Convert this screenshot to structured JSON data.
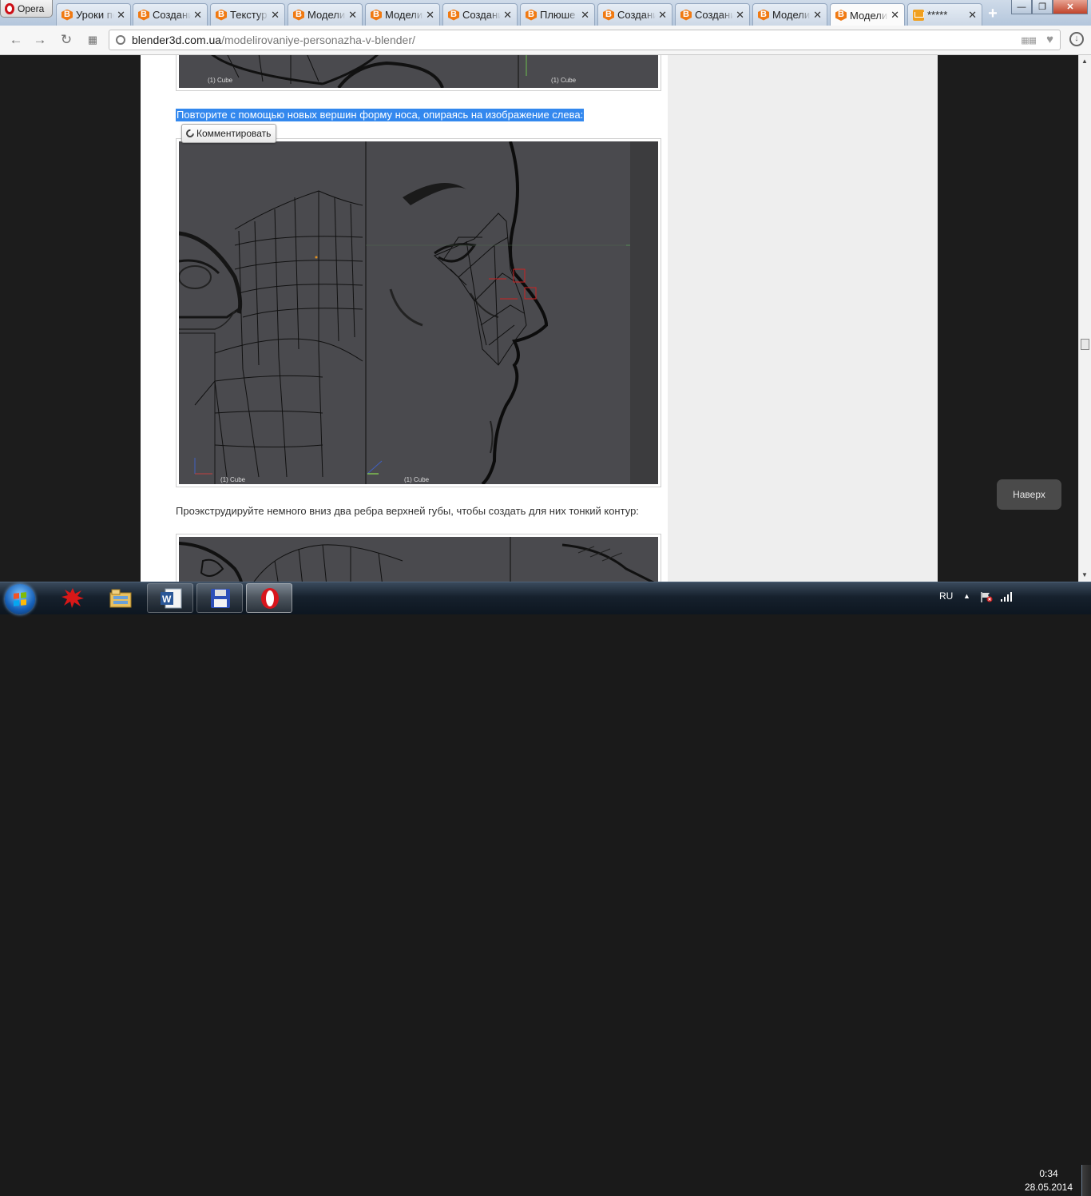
{
  "browser": {
    "menu_label": "Opera",
    "tabs": [
      {
        "title": "Уроки по",
        "icon": "blender3d-favicon",
        "close": "✕"
      },
      {
        "title": "Создание",
        "icon": "blender3d-favicon",
        "close": "✕"
      },
      {
        "title": "Текстур",
        "icon": "blender3d-favicon",
        "close": "✕"
      },
      {
        "title": "Модели",
        "icon": "blender3d-favicon",
        "close": "✕"
      },
      {
        "title": "Модели",
        "icon": "blender3d-favicon",
        "close": "✕"
      },
      {
        "title": "Создани",
        "icon": "blender3d-favicon",
        "close": "✕"
      },
      {
        "title": "Плюше",
        "icon": "blender3d-favicon",
        "close": "✕"
      },
      {
        "title": "Создани",
        "icon": "blender3d-favicon",
        "close": "✕"
      },
      {
        "title": "Создани",
        "icon": "blender3d-favicon",
        "close": "✕"
      },
      {
        "title": "Модели",
        "icon": "blender3d-favicon",
        "close": "✕"
      },
      {
        "title": "Модели",
        "icon": "blender3d-favicon",
        "close": "✕",
        "active": true
      },
      {
        "title": "*****",
        "icon": "mail-favicon",
        "close": "✕"
      }
    ],
    "new_tab_label": "+",
    "address": {
      "host": "blender3d.com.ua",
      "path": "/modelirovaniye-personazha-v-blender/"
    }
  },
  "article": {
    "highlighted_text": "Повторите с помощью новых вершин форму носа, опираясь на изображение слева:",
    "comment_button": "Комментировать",
    "paragraph_2": "Проэкструдируйте немного вниз два ребра верхней губы, чтобы создать для них тонкий контур:",
    "viewport_labels": [
      "(1) Cube",
      "(1) Cube",
      "(1) Cube",
      "(1) Cube"
    ]
  },
  "back_to_top": "Наверх",
  "taskbar": {
    "apps": [
      {
        "name": "red-splat-app-icon"
      },
      {
        "name": "file-explorer-icon"
      },
      {
        "name": "word-icon",
        "label": "W"
      },
      {
        "name": "floppy-save-icon"
      },
      {
        "name": "opera-icon"
      }
    ],
    "language": "RU",
    "time": "0:34",
    "date": "28.05.2014"
  },
  "colors": {
    "selection": "#3388ee",
    "viewport_bg": "#4a4a4e",
    "page_bg": "#eeeeee",
    "dark_side": "#1c1c1c"
  }
}
